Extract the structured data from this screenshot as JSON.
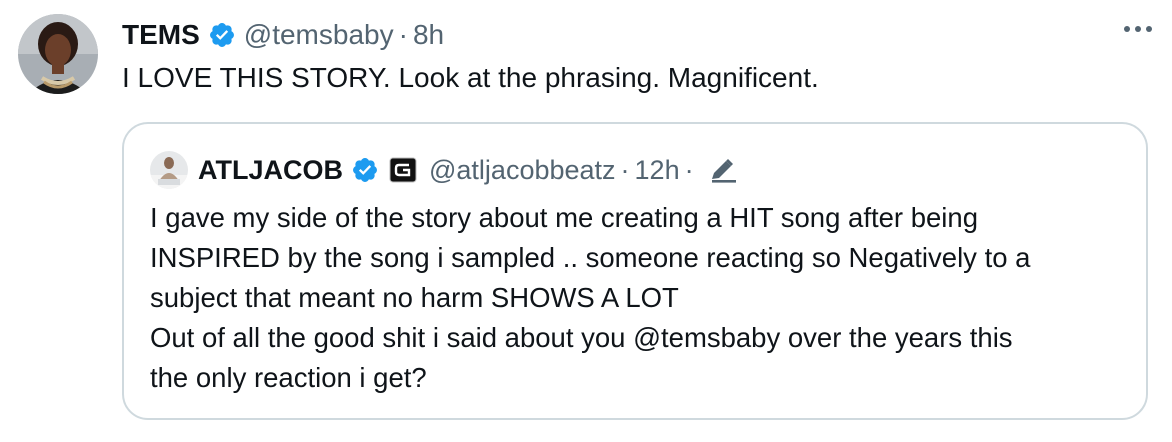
{
  "tweet": {
    "author_name": "TEMS",
    "handle": "@temsbaby",
    "separator": "·",
    "time": "8h",
    "text": "I LOVE THIS STORY. Look at the phrasing. Magnificent.",
    "avatar_icon": "user-avatar-photo",
    "verified_icon": "verified-badge-icon",
    "more_icon": "more-options-icon"
  },
  "quote": {
    "author_name": "ATLJACOB",
    "handle": "@atljacobbeatz",
    "separator": "·",
    "time": "12h",
    "separator2": "·",
    "edit_icon": "pencil-edit-icon",
    "affiliate_icon": "affiliate-badge-icon",
    "lines": [
      "I gave my side of the story about me creating a HIT song after being",
      "INSPIRED by the song i sampled .. someone reacting so Negatively to a",
      "subject that meant no harm SHOWS A LOT",
      "Out of all the good shit i said about you @temsbaby over the years this",
      "the only reaction i get?"
    ]
  },
  "colors": {
    "text": "#0f1419",
    "secondary": "#536471",
    "verified_blue": "#1d9bf0",
    "border": "#cfd9de"
  }
}
